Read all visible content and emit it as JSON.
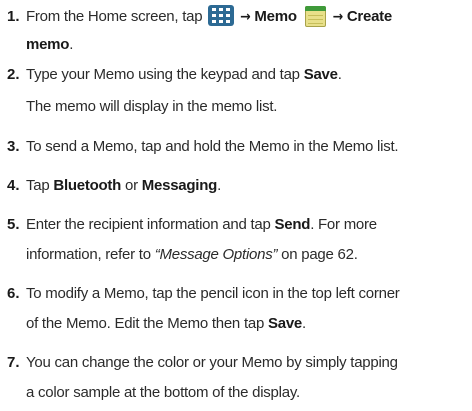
{
  "steps": [
    {
      "number": "1.",
      "pre": "From the Home screen, tap",
      "arrow1": "→",
      "memo_label": "Memo",
      "arrow2": "→",
      "create_label": "Create",
      "create_label2": "memo",
      "end": ".",
      "icons": [
        "apps-grid-icon",
        "memo-app-icon"
      ]
    },
    {
      "number": "2.",
      "pre": "Type your Memo using the keypad and tap",
      "save": "Save",
      "end": ".",
      "sub": "The memo will display in the memo list."
    },
    {
      "number": "3.",
      "text": "To send a Memo, tap and hold the Memo in the Memo list."
    },
    {
      "number": "4.",
      "pre": "Tap",
      "bluetooth": "Bluetooth",
      "mid": "or",
      "messaging": "Messaging",
      "end": "."
    },
    {
      "number": "5.",
      "pre": "Enter the recipient information and tap",
      "send": "Send",
      "post": ". For more",
      "line2_pre": "information, refer to",
      "ref": "“Message Options”",
      "line2_post": " on page 62."
    },
    {
      "number": "6.",
      "line1": "To modify a Memo, tap the pencil icon in the top left corner",
      "line2_pre": "of the Memo. Edit the Memo then tap",
      "save": "Save",
      "end": "."
    },
    {
      "number": "7.",
      "line1": "You can change the color or your Memo by simply tapping",
      "line2": "a color sample at the bottom of the display."
    }
  ]
}
